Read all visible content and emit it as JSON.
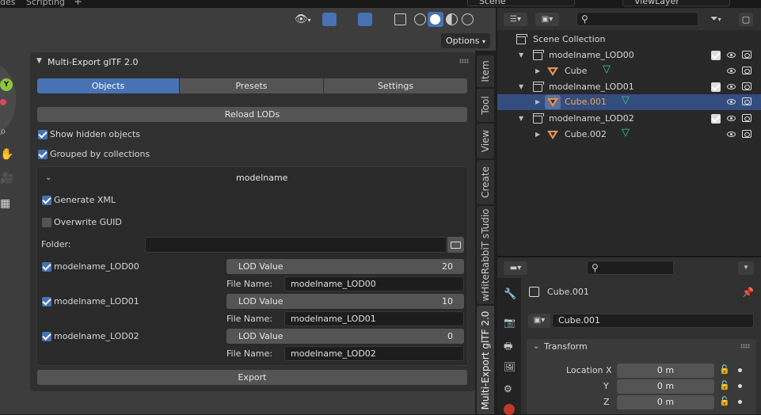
{
  "topbar": {
    "tab_left": "des",
    "tab_scripting": "Scripting",
    "add_tab": "+",
    "scene": "Scene",
    "view_layer": "ViewLayer"
  },
  "viewport": {
    "options_label": "Options",
    "axis_y": "Y"
  },
  "panel": {
    "title": "Multi-Export glTF 2.0",
    "tabs": [
      "Objects",
      "Presets",
      "Settings"
    ],
    "active_tab": "Objects",
    "reload_button": "Reload LODs",
    "show_hidden": "Show hidden objects",
    "grouped": "Grouped by collections",
    "group_name": "modelname",
    "generate_xml": "Generate XML",
    "overwrite_guid": "Overwrite GUID",
    "folder_label": "Folder:",
    "folder_value": "",
    "lods": [
      {
        "name": "modelname_LOD00",
        "lod_label": "LOD Value",
        "lod_value": "20",
        "file_label": "File Name:",
        "file_name": "modelname_LOD00"
      },
      {
        "name": "modelname_LOD01",
        "lod_label": "LOD Value",
        "lod_value": "10",
        "file_label": "File Name:",
        "file_name": "modelname_LOD01"
      },
      {
        "name": "modelname_LOD02",
        "lod_label": "LOD Value",
        "lod_value": "0",
        "file_label": "File Name:",
        "file_name": "modelname_LOD02"
      }
    ],
    "export_button": "Export"
  },
  "side_tabs": [
    "Item",
    "Tool",
    "View",
    "Create",
    "wHiteRabbiT sTudio",
    "Multi-Export glTF 2.0"
  ],
  "outliner": {
    "root": "Scene Collection",
    "rows": [
      {
        "label": "modelname_LOD00",
        "type": "collection"
      },
      {
        "label": "Cube",
        "type": "object"
      },
      {
        "label": "modelname_LOD01",
        "type": "collection"
      },
      {
        "label": "Cube.001",
        "type": "object",
        "selected": true
      },
      {
        "label": "modelname_LOD02",
        "type": "collection"
      },
      {
        "label": "Cube.002",
        "type": "object"
      }
    ]
  },
  "properties": {
    "object_name": "Cube.001",
    "data_name": "Cube.001",
    "section": "Transform",
    "location_label": "Location X",
    "fields": [
      {
        "axis": "Location X",
        "value": "0 m"
      },
      {
        "axis": "Y",
        "value": "0 m"
      },
      {
        "axis": "Z",
        "value": "0 m"
      }
    ]
  },
  "colors": {
    "accent": "#4772b3",
    "object_orange": "#e6914f",
    "selected_text": "#f0a94a",
    "mesh_green": "#3ad08a"
  }
}
